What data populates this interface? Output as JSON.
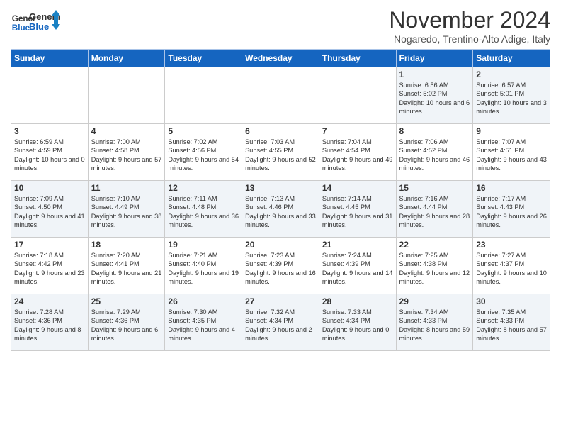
{
  "logo": {
    "line1": "General",
    "line2": "Blue"
  },
  "title": "November 2024",
  "location": "Nogaredo, Trentino-Alto Adige, Italy",
  "days_of_week": [
    "Sunday",
    "Monday",
    "Tuesday",
    "Wednesday",
    "Thursday",
    "Friday",
    "Saturday"
  ],
  "weeks": [
    [
      {
        "day": "",
        "info": ""
      },
      {
        "day": "",
        "info": ""
      },
      {
        "day": "",
        "info": ""
      },
      {
        "day": "",
        "info": ""
      },
      {
        "day": "",
        "info": ""
      },
      {
        "day": "1",
        "info": "Sunrise: 6:56 AM\nSunset: 5:02 PM\nDaylight: 10 hours and 6 minutes."
      },
      {
        "day": "2",
        "info": "Sunrise: 6:57 AM\nSunset: 5:01 PM\nDaylight: 10 hours and 3 minutes."
      }
    ],
    [
      {
        "day": "3",
        "info": "Sunrise: 6:59 AM\nSunset: 4:59 PM\nDaylight: 10 hours and 0 minutes."
      },
      {
        "day": "4",
        "info": "Sunrise: 7:00 AM\nSunset: 4:58 PM\nDaylight: 9 hours and 57 minutes."
      },
      {
        "day": "5",
        "info": "Sunrise: 7:02 AM\nSunset: 4:56 PM\nDaylight: 9 hours and 54 minutes."
      },
      {
        "day": "6",
        "info": "Sunrise: 7:03 AM\nSunset: 4:55 PM\nDaylight: 9 hours and 52 minutes."
      },
      {
        "day": "7",
        "info": "Sunrise: 7:04 AM\nSunset: 4:54 PM\nDaylight: 9 hours and 49 minutes."
      },
      {
        "day": "8",
        "info": "Sunrise: 7:06 AM\nSunset: 4:52 PM\nDaylight: 9 hours and 46 minutes."
      },
      {
        "day": "9",
        "info": "Sunrise: 7:07 AM\nSunset: 4:51 PM\nDaylight: 9 hours and 43 minutes."
      }
    ],
    [
      {
        "day": "10",
        "info": "Sunrise: 7:09 AM\nSunset: 4:50 PM\nDaylight: 9 hours and 41 minutes."
      },
      {
        "day": "11",
        "info": "Sunrise: 7:10 AM\nSunset: 4:49 PM\nDaylight: 9 hours and 38 minutes."
      },
      {
        "day": "12",
        "info": "Sunrise: 7:11 AM\nSunset: 4:48 PM\nDaylight: 9 hours and 36 minutes."
      },
      {
        "day": "13",
        "info": "Sunrise: 7:13 AM\nSunset: 4:46 PM\nDaylight: 9 hours and 33 minutes."
      },
      {
        "day": "14",
        "info": "Sunrise: 7:14 AM\nSunset: 4:45 PM\nDaylight: 9 hours and 31 minutes."
      },
      {
        "day": "15",
        "info": "Sunrise: 7:16 AM\nSunset: 4:44 PM\nDaylight: 9 hours and 28 minutes."
      },
      {
        "day": "16",
        "info": "Sunrise: 7:17 AM\nSunset: 4:43 PM\nDaylight: 9 hours and 26 minutes."
      }
    ],
    [
      {
        "day": "17",
        "info": "Sunrise: 7:18 AM\nSunset: 4:42 PM\nDaylight: 9 hours and 23 minutes."
      },
      {
        "day": "18",
        "info": "Sunrise: 7:20 AM\nSunset: 4:41 PM\nDaylight: 9 hours and 21 minutes."
      },
      {
        "day": "19",
        "info": "Sunrise: 7:21 AM\nSunset: 4:40 PM\nDaylight: 9 hours and 19 minutes."
      },
      {
        "day": "20",
        "info": "Sunrise: 7:23 AM\nSunset: 4:39 PM\nDaylight: 9 hours and 16 minutes."
      },
      {
        "day": "21",
        "info": "Sunrise: 7:24 AM\nSunset: 4:39 PM\nDaylight: 9 hours and 14 minutes."
      },
      {
        "day": "22",
        "info": "Sunrise: 7:25 AM\nSunset: 4:38 PM\nDaylight: 9 hours and 12 minutes."
      },
      {
        "day": "23",
        "info": "Sunrise: 7:27 AM\nSunset: 4:37 PM\nDaylight: 9 hours and 10 minutes."
      }
    ],
    [
      {
        "day": "24",
        "info": "Sunrise: 7:28 AM\nSunset: 4:36 PM\nDaylight: 9 hours and 8 minutes."
      },
      {
        "day": "25",
        "info": "Sunrise: 7:29 AM\nSunset: 4:36 PM\nDaylight: 9 hours and 6 minutes."
      },
      {
        "day": "26",
        "info": "Sunrise: 7:30 AM\nSunset: 4:35 PM\nDaylight: 9 hours and 4 minutes."
      },
      {
        "day": "27",
        "info": "Sunrise: 7:32 AM\nSunset: 4:34 PM\nDaylight: 9 hours and 2 minutes."
      },
      {
        "day": "28",
        "info": "Sunrise: 7:33 AM\nSunset: 4:34 PM\nDaylight: 9 hours and 0 minutes."
      },
      {
        "day": "29",
        "info": "Sunrise: 7:34 AM\nSunset: 4:33 PM\nDaylight: 8 hours and 59 minutes."
      },
      {
        "day": "30",
        "info": "Sunrise: 7:35 AM\nSunset: 4:33 PM\nDaylight: 8 hours and 57 minutes."
      }
    ]
  ]
}
